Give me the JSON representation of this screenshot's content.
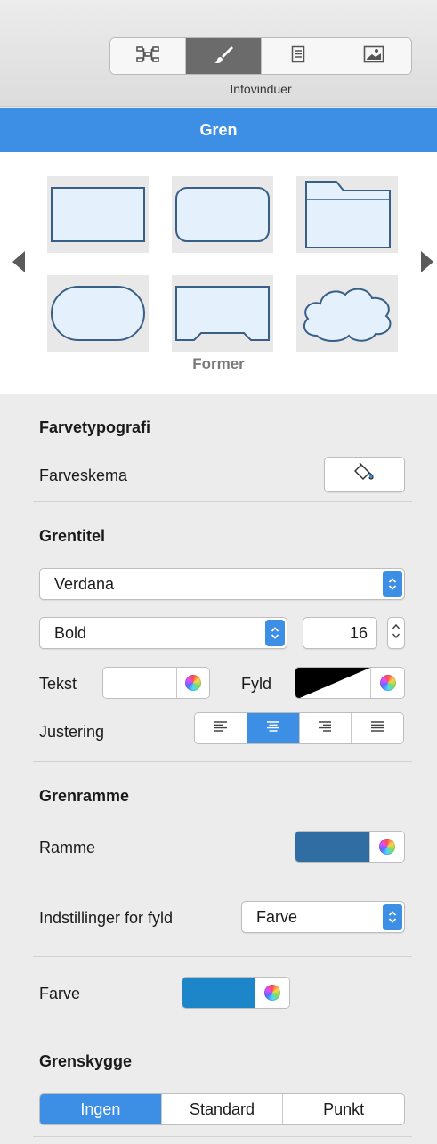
{
  "toolbar": {
    "tabs": [
      {
        "icon": "structure-icon",
        "active": false
      },
      {
        "icon": "paintbrush-icon",
        "active": true
      },
      {
        "icon": "document-icon",
        "active": false
      },
      {
        "icon": "image-icon",
        "active": false
      }
    ],
    "label": "Infovinduer"
  },
  "header": {
    "title": "Gren"
  },
  "shapes": {
    "label": "Former",
    "items": [
      "rectangle",
      "rounded-rectangle",
      "folder",
      "stadium",
      "notched-rectangle",
      "cloud"
    ],
    "fill": "#e4f0fb",
    "stroke": "#3a5f86"
  },
  "color_typography": {
    "title": "Farvetypografi",
    "scheme_label": "Farveskema"
  },
  "branch_title": {
    "title": "Grentitel",
    "font": "Verdana",
    "weight": "Bold",
    "size": "16",
    "text_label": "Tekst",
    "fill_label": "Fyld",
    "align_label": "Justering",
    "align_options": [
      "left",
      "center",
      "right",
      "justify"
    ],
    "align_selected": "center",
    "text_color": "#ffffff"
  },
  "branch_border": {
    "title": "Grenramme",
    "border_label": "Ramme",
    "border_color": "#2f6da2"
  },
  "fill_settings": {
    "label": "Indstillinger for fyld",
    "value": "Farve"
  },
  "fill_color": {
    "label": "Farve",
    "color": "#1c86c8"
  },
  "branch_shadow": {
    "title": "Grenskygge",
    "options": [
      "Ingen",
      "Standard",
      "Punkt"
    ],
    "selected": "Ingen"
  },
  "colors": {
    "accent": "#3d8fe5",
    "panel": "#ececec"
  }
}
